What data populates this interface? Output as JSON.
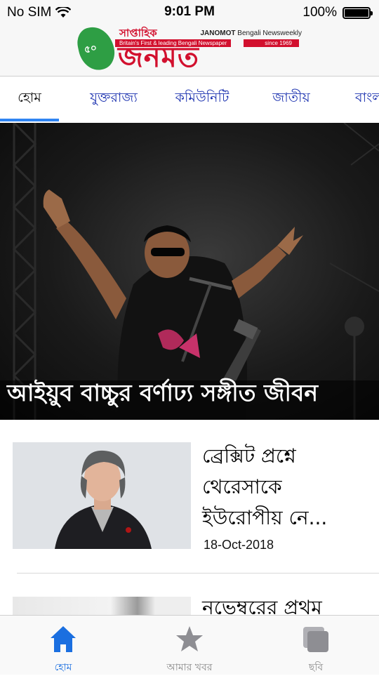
{
  "status_bar": {
    "carrier": "No SIM",
    "time": "9:01 PM",
    "battery_percent": "100%",
    "battery_level": 1.0
  },
  "header": {
    "logo_label_top": "সাপ্তাহিক",
    "logo_tagline": "Britain's First & leading Bengali Newspaper",
    "logo_name": "জনমত",
    "logo_seal_text": "৫০",
    "english_name_bold": "JANOMOT",
    "english_name_rest": " Bengali Newsweekly",
    "since": "since 1969"
  },
  "tabs": [
    {
      "label": "হোম",
      "active": true
    },
    {
      "label": "যুক্তরাজ্য",
      "active": false
    },
    {
      "label": "কমিউনিটি",
      "active": false
    },
    {
      "label": "জাতীয়",
      "active": false
    },
    {
      "label": "বাংলা",
      "active": false
    }
  ],
  "hero": {
    "headline": "আইয়ুব বাচ্চুর বর্ণাঢ্য সঙ্গীত জীবন"
  },
  "news": [
    {
      "title": "ব্রেক্সিট প্রশ্নে থেরেসাকে ইউরোপীয় নে...",
      "date": "18-Oct-2018"
    },
    {
      "title": "নভেম্বরের প্রথম",
      "date": ""
    }
  ],
  "tab_bar": [
    {
      "label": "হোম",
      "icon": "home-icon",
      "active": true
    },
    {
      "label": "আমার খবর",
      "icon": "star-icon",
      "active": false
    },
    {
      "label": "ছবি",
      "icon": "gallery-icon",
      "active": false
    }
  ],
  "colors": {
    "accent": "#2f84f2",
    "brand_red": "#d2102e",
    "tab_text": "#1d33b0",
    "tab_active_icon": "#1b6fe0",
    "tab_inactive_icon": "#8e8e93"
  }
}
